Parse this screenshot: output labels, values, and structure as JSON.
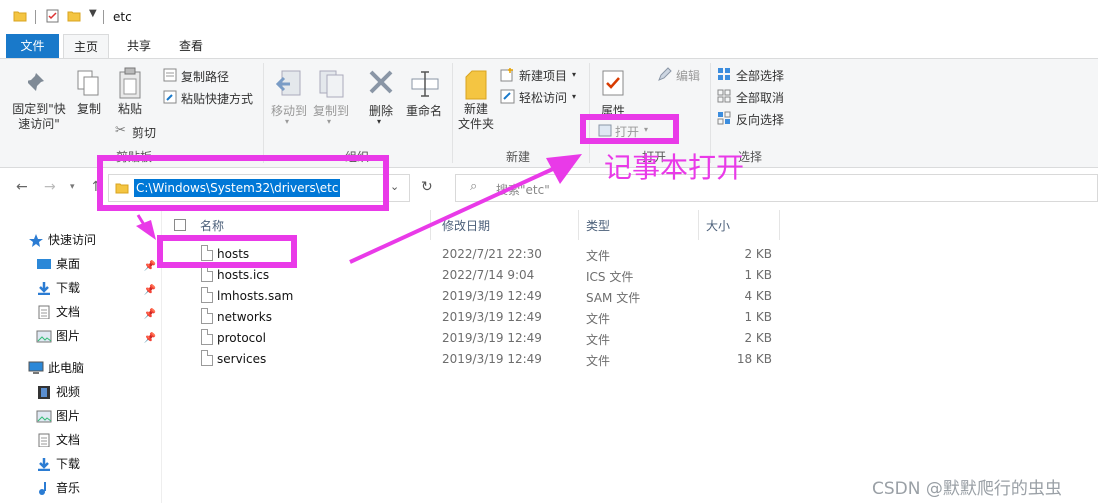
{
  "window": {
    "title": "etc"
  },
  "tabs": {
    "file": "文件",
    "home": "主页",
    "share": "共享",
    "view": "查看"
  },
  "ribbon": {
    "pin_quick": "固定到\"快\n速访问\"",
    "copy": "复制",
    "paste": "粘贴",
    "copy_path": "复制路径",
    "paste_shortcut": "粘贴快捷方式",
    "cut": "剪切",
    "clipboard_group": "剪贴板",
    "move_to": "移动到",
    "copy_to": "复制到",
    "delete": "删除",
    "rename": "重命名",
    "organize_group": "组织",
    "new_folder": "新建\n文件夹",
    "new_item": "新建项目",
    "easy_access": "轻松访问",
    "new_group": "新建",
    "properties": "属性",
    "open": "打开",
    "edit": "编辑",
    "open_group": "打开",
    "select_all": "全部选择",
    "select_none": "全部取消",
    "invert_selection": "反向选择",
    "select_group": "选择"
  },
  "address": {
    "path": "C:\\Windows\\System32\\drivers\\etc",
    "search_placeholder": "搜索\"etc\""
  },
  "sidebar": {
    "items": [
      {
        "label": "快速访问",
        "icon": "star-icon",
        "pinned": false
      },
      {
        "label": "桌面",
        "icon": "desktop-icon",
        "pinned": true
      },
      {
        "label": "下载",
        "icon": "download-icon",
        "pinned": true
      },
      {
        "label": "文档",
        "icon": "document-icon",
        "pinned": true
      },
      {
        "label": "图片",
        "icon": "picture-icon",
        "pinned": true
      },
      {
        "label": "此电脑",
        "icon": "computer-icon",
        "pinned": false
      },
      {
        "label": "视频",
        "icon": "video-icon",
        "pinned": false
      },
      {
        "label": "图片",
        "icon": "picture-icon",
        "pinned": false
      },
      {
        "label": "文档",
        "icon": "document-icon",
        "pinned": false
      },
      {
        "label": "下载",
        "icon": "download-icon",
        "pinned": false
      },
      {
        "label": "音乐",
        "icon": "music-icon",
        "pinned": false
      }
    ]
  },
  "columns": {
    "name": "名称",
    "date": "修改日期",
    "type": "类型",
    "size": "大小"
  },
  "files": [
    {
      "name": "hosts",
      "date": "2022/7/21 22:30",
      "type": "文件",
      "size": "2 KB"
    },
    {
      "name": "hosts.ics",
      "date": "2022/7/14 9:04",
      "type": "ICS 文件",
      "size": "1 KB"
    },
    {
      "name": "lmhosts.sam",
      "date": "2019/3/19 12:49",
      "type": "SAM 文件",
      "size": "4 KB"
    },
    {
      "name": "networks",
      "date": "2019/3/19 12:49",
      "type": "文件",
      "size": "1 KB"
    },
    {
      "name": "protocol",
      "date": "2019/3/19 12:49",
      "type": "文件",
      "size": "2 KB"
    },
    {
      "name": "services",
      "date": "2019/3/19 12:49",
      "type": "文件",
      "size": "18 KB"
    }
  ],
  "annotation": {
    "text": "记事本打开",
    "color": "#e93ae8"
  },
  "watermark": "CSDN @默默爬行的虫虫",
  "colors": {
    "accent": "#1979ca",
    "selection": "#0078d7",
    "highlight": "#e93ae8"
  }
}
